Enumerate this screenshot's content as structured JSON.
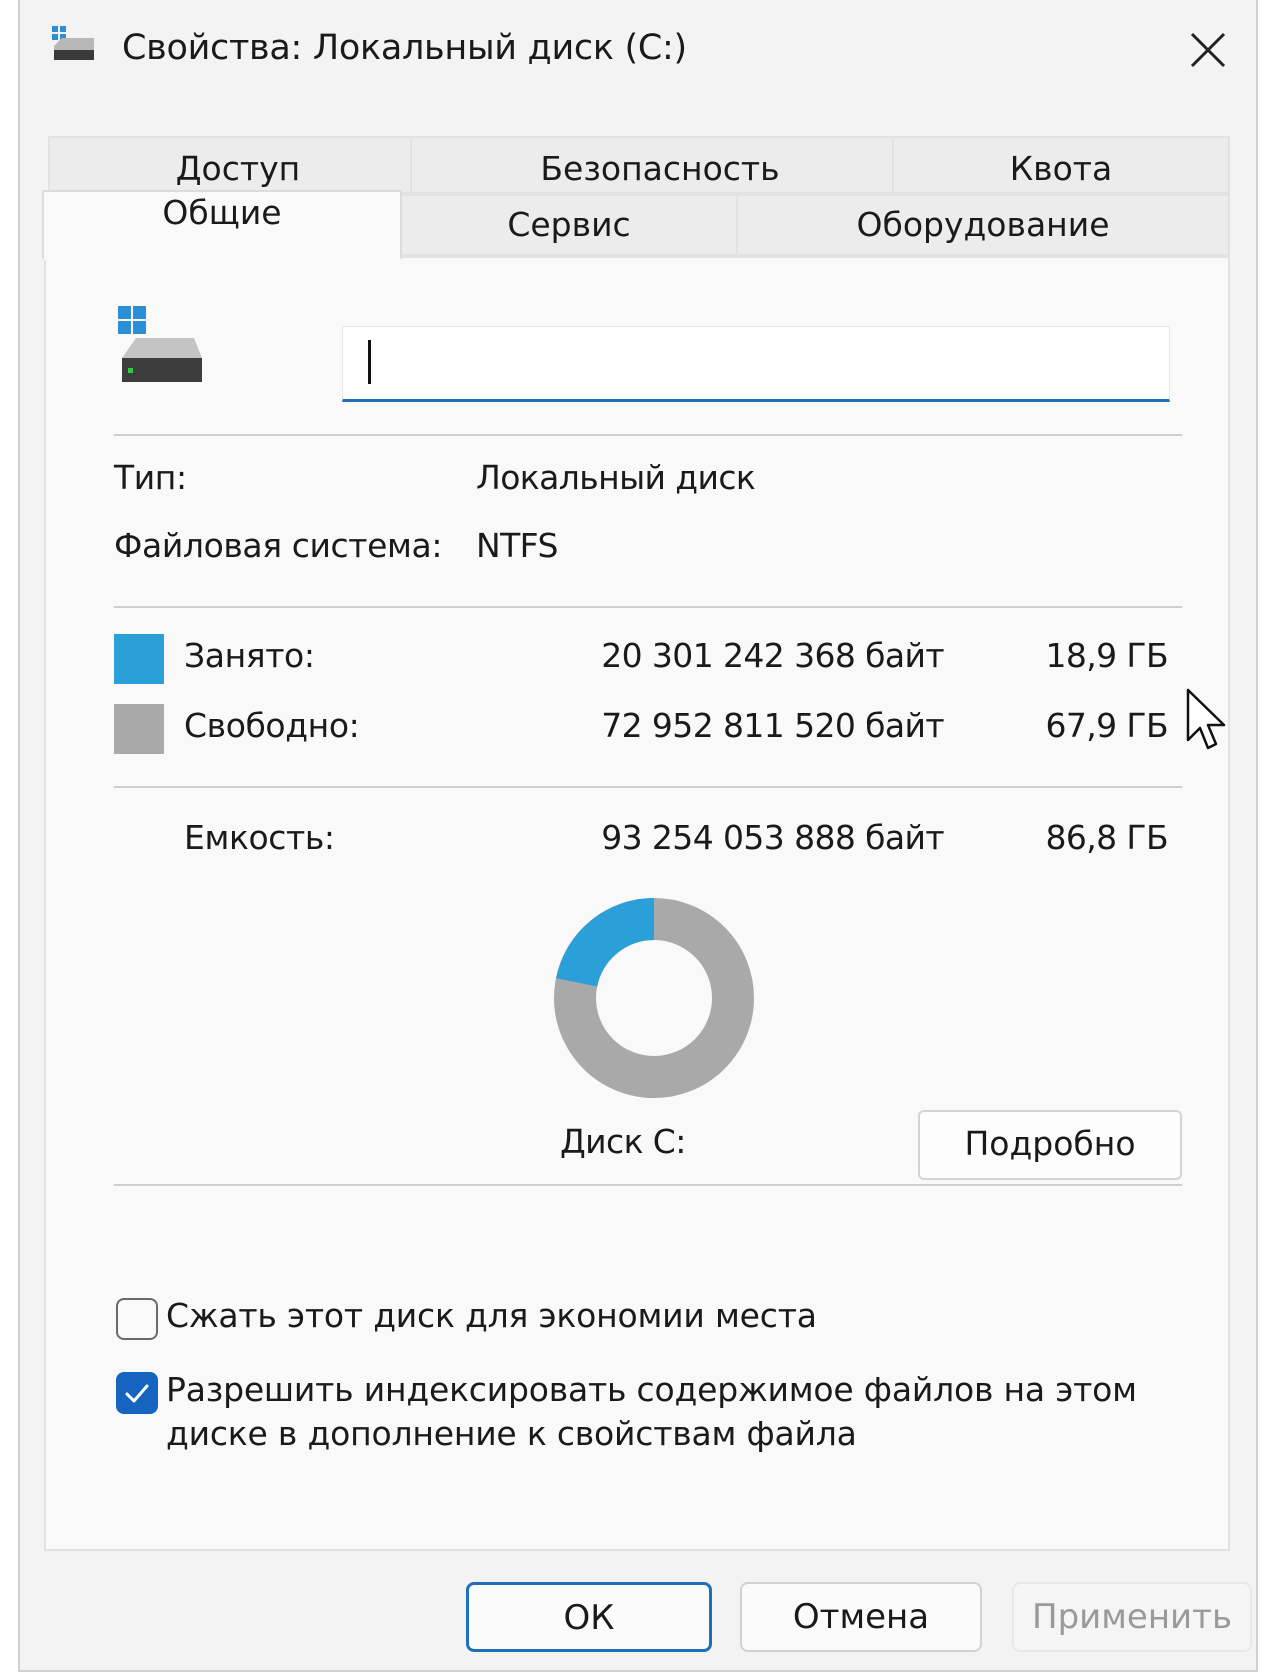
{
  "window": {
    "title": "Свойства: Локальный диск (C:)"
  },
  "tabs": {
    "row1": [
      "Доступ",
      "Безопасность",
      "Квота"
    ],
    "row2": [
      "Общие",
      "Сервис",
      "Оборудование"
    ],
    "active": "Общие"
  },
  "general": {
    "name_value": "",
    "type_label": "Тип:",
    "type_value": "Локальный диск",
    "fs_label": "Файловая система:",
    "fs_value": "NTFS",
    "used_label": "Занято:",
    "used_bytes": "20 301 242 368 байт",
    "used_gb": "18,9 ГБ",
    "free_label": "Свободно:",
    "free_bytes": "72 952 811 520 байт",
    "free_gb": "67,9 ГБ",
    "capacity_label": "Емкость:",
    "capacity_bytes": "93 254 053 888 байт",
    "capacity_gb": "86,8 ГБ",
    "used_fraction": 0.218,
    "used_color": "#2a9fd8",
    "free_color": "#a9a9a9",
    "disk_label": "Диск C:",
    "details_button": "Подробно",
    "compress_label": "Сжать этот диск для экономии места",
    "compress_checked": false,
    "index_label": "Разрешить индексировать содержимое файлов на этом диске в дополнение к свойствам файла",
    "index_checked": true
  },
  "buttons": {
    "ok": "ОК",
    "cancel": "Отмена",
    "apply": "Применить"
  },
  "icons": {
    "title": "drive-icon",
    "close": "close-icon",
    "drive": "windows-drive-icon",
    "checkmark": "checkmark-icon",
    "pointer": "mouse-pointer-icon"
  }
}
